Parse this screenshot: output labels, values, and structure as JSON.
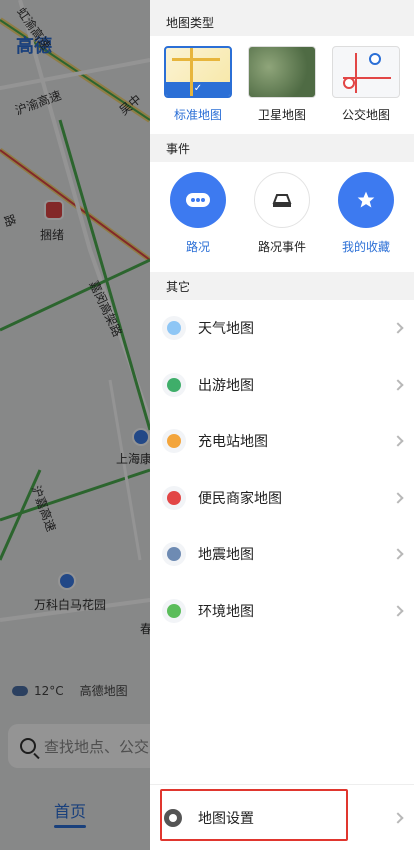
{
  "map": {
    "logo": "高德",
    "roads": [
      "虹渝高速",
      "沪渝高速",
      "吴中",
      "嘉闵高架路",
      "沪嘉高速",
      "路"
    ],
    "pois": [
      "捆绪",
      "上海康",
      "万科白马花园",
      "春"
    ],
    "weather": "12°C",
    "mapname": "高德地图",
    "search_placeholder": "查找地点、公交",
    "home_tab": "首页"
  },
  "drawer": {
    "map_type_header": "地图类型",
    "map_types": [
      {
        "label": "标准地图",
        "selected": true
      },
      {
        "label": "卫星地图",
        "selected": false
      },
      {
        "label": "公交地图",
        "selected": false
      }
    ],
    "events_header": "事件",
    "events": [
      {
        "label": "路况",
        "style": "blue"
      },
      {
        "label": "路况事件",
        "style": "white"
      },
      {
        "label": "我的收藏",
        "style": "blue"
      }
    ],
    "others_header": "其它",
    "others": [
      {
        "label": "天气地图",
        "color": "#8ec6f5"
      },
      {
        "label": "出游地图",
        "color": "#3fae6a"
      },
      {
        "label": "充电站地图",
        "color": "#f3a53c"
      },
      {
        "label": "便民商家地图",
        "color": "#e24646"
      },
      {
        "label": "地震地图",
        "color": "#6e8bb3"
      },
      {
        "label": "环境地图",
        "color": "#5bbd5b"
      }
    ],
    "settings_label": "地图设置"
  },
  "colors": {
    "accent": "#2b6fd6",
    "highlight": "#e0362e"
  }
}
